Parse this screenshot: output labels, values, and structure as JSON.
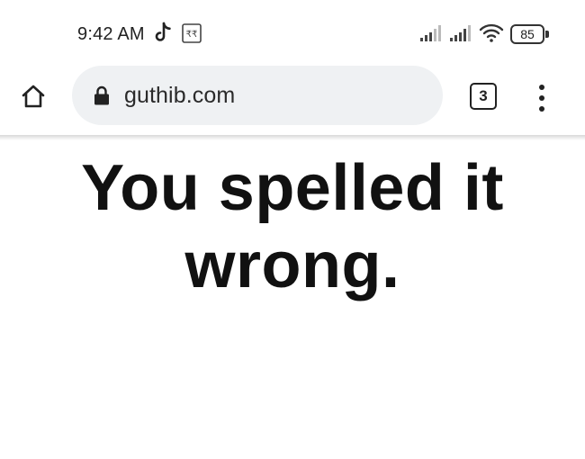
{
  "status_bar": {
    "time": "9:42 AM",
    "notification_icons": [
      "tiktok-icon",
      "rupee-app-icon"
    ],
    "rupee_glyph": "₹₹",
    "battery_level": "85",
    "indicators": [
      "signal-strength-icon",
      "signal-strength-icon",
      "wifi-icon",
      "battery-icon"
    ]
  },
  "browser": {
    "url": "guthib.com",
    "tab_count": "3",
    "icons": {
      "home": "home-icon",
      "lock": "lock-icon",
      "menu": "more-vertical-icon"
    }
  },
  "page": {
    "headline": "You spelled it wrong."
  },
  "colors": {
    "background": "#ffffff",
    "url_bar": "#eff1f3",
    "text": "#111111"
  }
}
